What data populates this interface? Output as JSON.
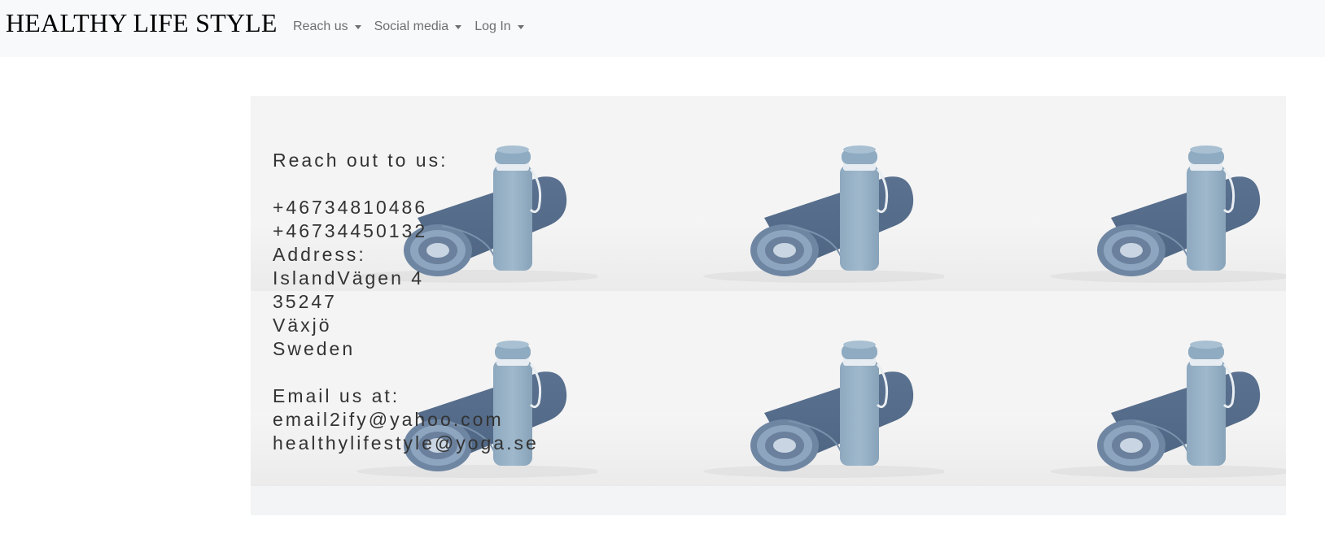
{
  "navbar": {
    "brand": "HEALTHY LIFE STYLE",
    "items": [
      {
        "label": "Reach us"
      },
      {
        "label": "Social media"
      },
      {
        "label": "Log In"
      }
    ]
  },
  "content": {
    "image_alt_icon": "yoga-mat-bottle-image",
    "contact": {
      "heading": "Reach out to us:",
      "phones": [
        "+46734810486",
        "+46734450132"
      ],
      "address_label": "Address:",
      "address_lines": [
        "IslandVägen 4",
        "35247",
        "Växjö",
        "Sweden"
      ],
      "email_label": "Email us at:",
      "emails": [
        "email2ify@yahoo.com",
        "healthylifestyle@yoga.se"
      ]
    }
  },
  "colors": {
    "navbar_bg": "#f8f9fa",
    "nav_text": "#6c6f73",
    "panel_bg": "#f3f4f6",
    "mat": "#4f6683",
    "bottle": "#9fb8cc",
    "text": "#333333"
  }
}
